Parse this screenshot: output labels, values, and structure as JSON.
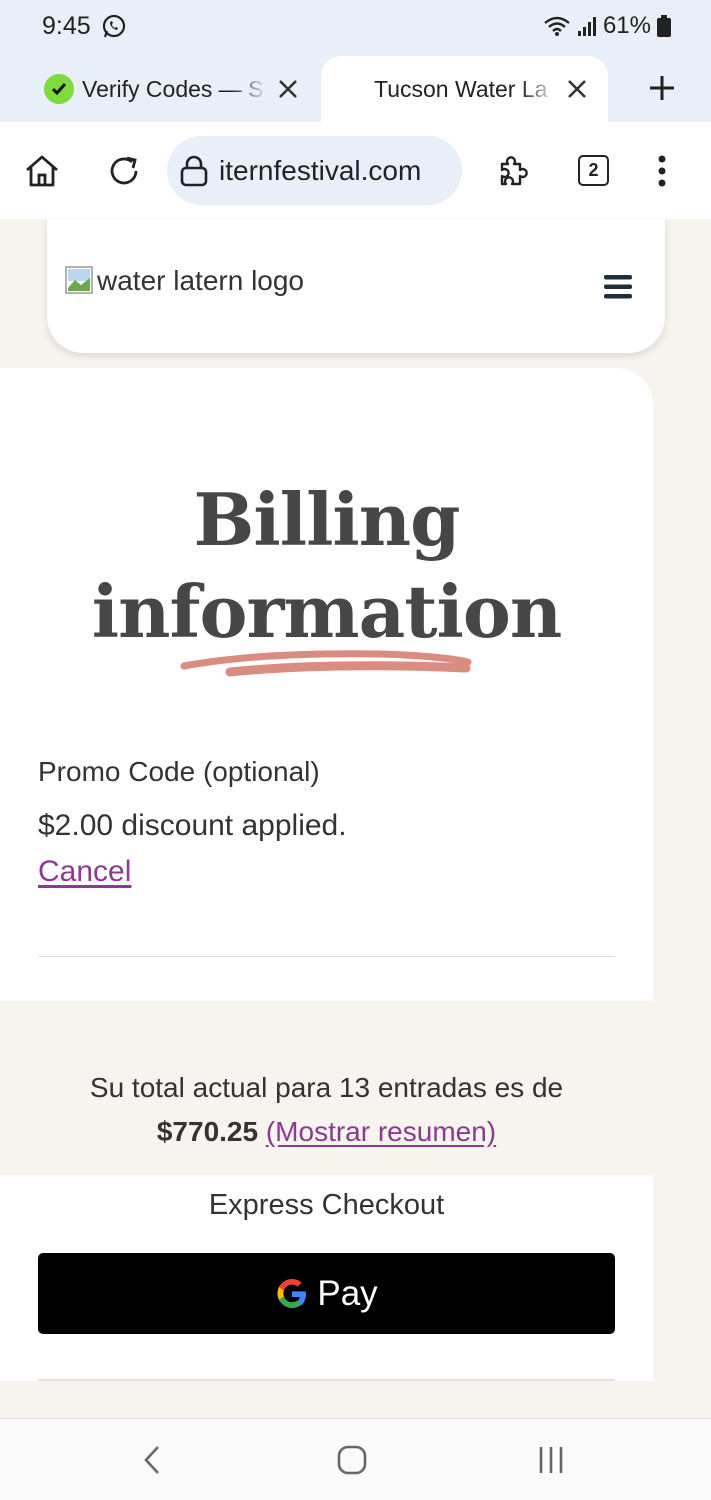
{
  "status_bar": {
    "time": "9:45",
    "battery": "61%",
    "icons": [
      "whatsapp-icon",
      "wifi-icon",
      "signal-icon",
      "battery-icon"
    ]
  },
  "tabs": [
    {
      "title": "Verify Codes — S",
      "active": false,
      "icon": "verify-favicon"
    },
    {
      "title": "Tucson Water La",
      "active": true
    }
  ],
  "toolbar": {
    "url": "iternfestival.com",
    "tab_count": "2",
    "icons": [
      "home-icon",
      "reload-icon",
      "lock-icon",
      "extensions-icon",
      "kebab-menu-icon"
    ]
  },
  "header": {
    "logo_alt": "water latern logo"
  },
  "billing": {
    "title_line1": "Billing",
    "title_line2": "information",
    "promo_label": "Promo Code (optional)",
    "discount": "$2.00 discount applied.",
    "cancel": "Cancel"
  },
  "summary": {
    "text": "Su total actual para 13 entradas es de",
    "amount": "$770.25",
    "link": "(Mostrar resumen)"
  },
  "express": {
    "title": "Express Checkout",
    "gpay_label": "Pay"
  },
  "colors": {
    "accent_link": "#8a3b8f",
    "underline_brush": "#d98c7f",
    "page_bg": "#f7f3ef"
  }
}
